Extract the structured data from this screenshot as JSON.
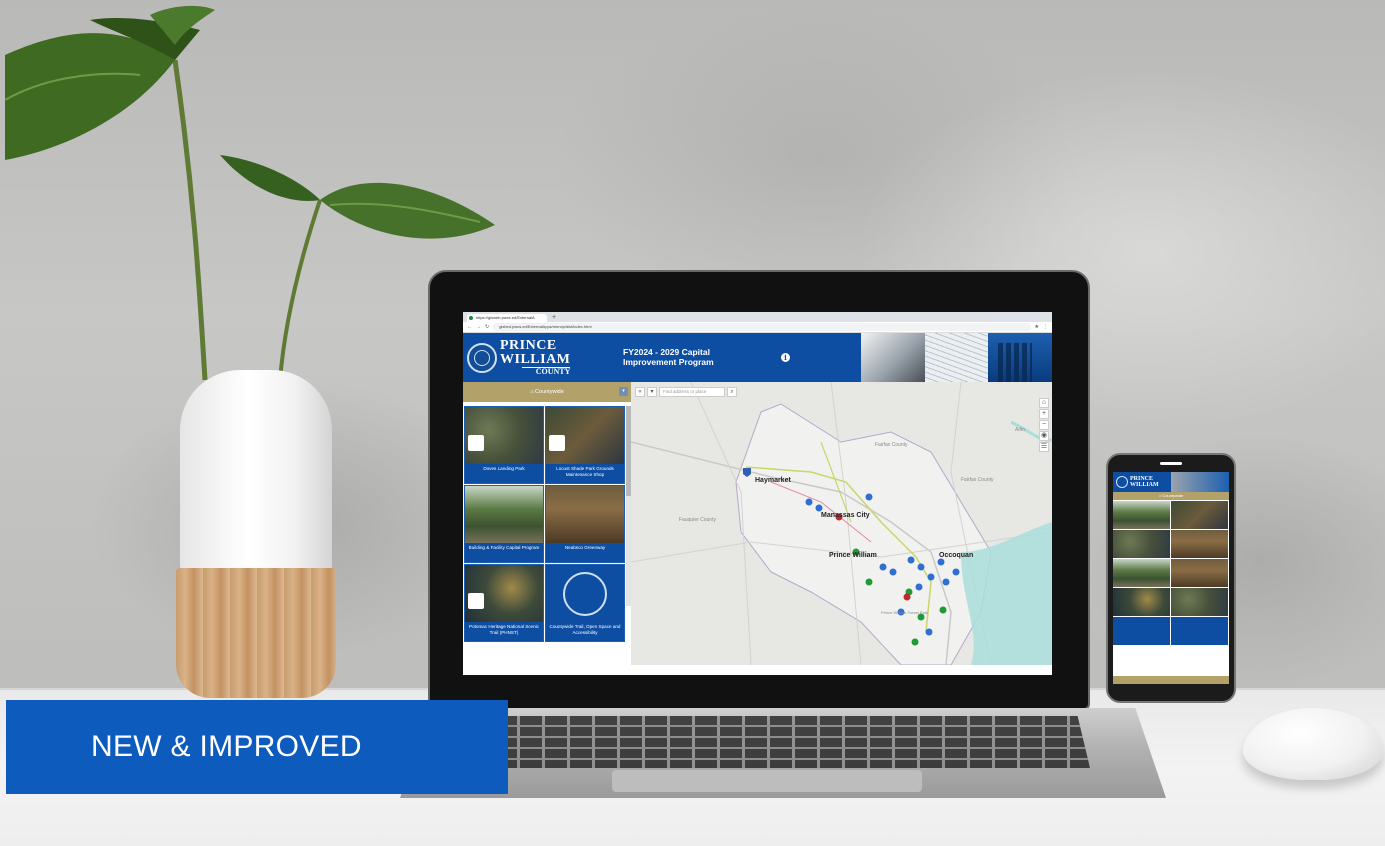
{
  "promo_banner": {
    "text": "NEW & IMPROVED"
  },
  "browser": {
    "tab_title": "https://gisweb.pwcs.ed/ExternalA",
    "new_tab": "+",
    "url": "gisbed.pwcs.ed/ExternalApps/mercip/dist/index.html"
  },
  "app": {
    "logo": {
      "line1": "PRINCE",
      "line2": "WILLIAM",
      "line3": "COUNTY"
    },
    "title_line1": "FY2024 - 2029 Capital",
    "title_line2": "Improvement Program",
    "info_icon": "i",
    "region_selector": "⌂ Countywide",
    "region_dropdown": "▾",
    "search_placeholder": "Find address or place",
    "projects": [
      {
        "label": "Doves Landing Park",
        "image": "aerial-map"
      },
      {
        "label": "Locust Shade Park Grounds Maintenance Shop",
        "image": "aerial-map"
      },
      {
        "label": "Building & Facility Capital Program",
        "image": "forest-photo"
      },
      {
        "label": "Neabsco Greenway",
        "image": "creek-photo"
      },
      {
        "label": "Potomac Heritage National Scenic Trail (PHNST)",
        "image": "aerial-map"
      },
      {
        "label": "Countywide Trail, Open Space and Accessibility",
        "image": "county-seal"
      }
    ],
    "map_labels": {
      "haymarket": "Haymarket",
      "manassas_city": "Manassas City",
      "prince_william": "Prince William",
      "occoquan": "Occoquan",
      "fairfax_county": "Fairfax County",
      "fairfax_county2": "Fairfax County",
      "fauquier_county": "Fauquier County",
      "arlington": "Arlin",
      "forest_park": "Prince William Forest Park"
    },
    "map_controls": [
      "⌂",
      "+",
      "−",
      "◉",
      "☰"
    ]
  },
  "colors": {
    "brand_blue": "#0d4ea3",
    "gold": "#b3a16a",
    "promo_blue": "#0d5bbd"
  }
}
